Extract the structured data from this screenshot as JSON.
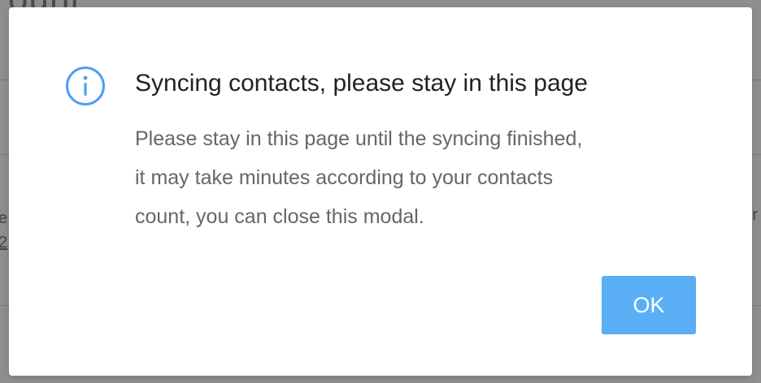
{
  "background": {
    "heading_fragment": "ount",
    "cell_left_line1": "e",
    "cell_left_line2": "2",
    "cell_right": "r"
  },
  "modal": {
    "icon": "info-icon",
    "title": "Syncing contacts, please stay in this page",
    "body_lines": [
      "Please stay in this page until the syncing finished,",
      "it may take minutes according to your contacts",
      "count, you can close this modal."
    ],
    "ok_label": "OK"
  },
  "colors": {
    "icon_blue": "#4a9ff5",
    "button_blue": "#5aaef6",
    "title_text": "#222222",
    "body_text": "#666666",
    "overlay": "#8f8f8f"
  }
}
